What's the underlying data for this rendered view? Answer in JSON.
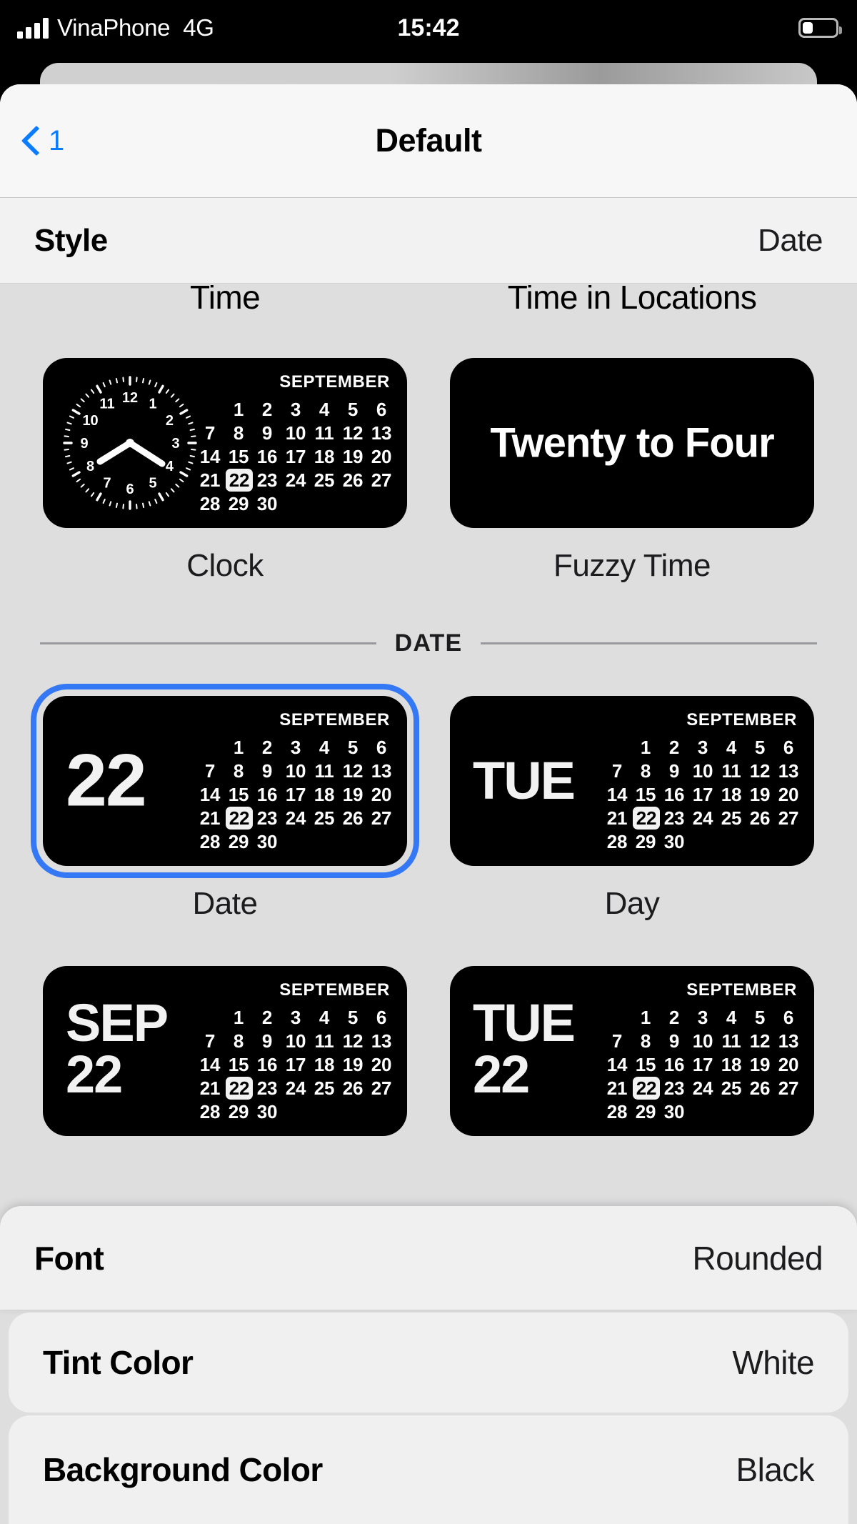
{
  "status_bar": {
    "carrier": "VinaPhone",
    "network": "4G",
    "time": "15:42",
    "battery_level_percent": 32
  },
  "nav": {
    "back_label": "1",
    "title": "Default"
  },
  "style_row": {
    "label": "Style",
    "value": "Date"
  },
  "calendar": {
    "month_label": "SEPTEMBER",
    "today": 22,
    "leading_blanks": 1,
    "days_in_month": 30,
    "weeks": [
      [
        "",
        "1",
        "2",
        "3",
        "4",
        "5",
        "6"
      ],
      [
        "7",
        "8",
        "9",
        "10",
        "11",
        "12",
        "13"
      ],
      [
        "14",
        "15",
        "16",
        "17",
        "18",
        "19",
        "20"
      ],
      [
        "21",
        "22",
        "23",
        "24",
        "25",
        "26",
        "27"
      ],
      [
        "28",
        "29",
        "30",
        "",
        "",
        "",
        ""
      ]
    ]
  },
  "time_section": {
    "cut_labels": [
      "Time",
      "Time in Locations"
    ],
    "items": [
      {
        "label": "Clock",
        "kind": "analog-clock",
        "glyph": "",
        "selected": false
      },
      {
        "label": "Fuzzy Time",
        "kind": "fuzzy",
        "glyph": "Twenty to Four",
        "selected": false
      }
    ]
  },
  "date_section": {
    "header": "DATE",
    "items": [
      {
        "label": "Date",
        "kind": "glyph",
        "glyph": "22",
        "selected": true
      },
      {
        "label": "Day",
        "kind": "glyph",
        "glyph": "TUE",
        "selected": false
      },
      {
        "label": "",
        "kind": "glyph-two-line",
        "glyph_line1": "SEP",
        "glyph_line2": "22",
        "selected": false
      },
      {
        "label": "",
        "kind": "glyph-two-line",
        "glyph_line1": "TUE",
        "glyph_line2": "22",
        "selected": false
      }
    ]
  },
  "clock_widget": {
    "hour_numbers": [
      "12",
      "1",
      "2",
      "3",
      "4",
      "5",
      "6",
      "7",
      "8",
      "9",
      "10",
      "11"
    ],
    "hand_time": "3:42"
  },
  "bottom_options": [
    {
      "label": "Font",
      "value": "Rounded"
    },
    {
      "label": "Tint Color",
      "value": "White"
    },
    {
      "label": "Background Color",
      "value": "Black"
    }
  ],
  "colors": {
    "accent_blue": "#3478f6",
    "nav_tint": "#0a7cff",
    "widget_background": "#000000",
    "scroll_background": "#dededf",
    "sheet_background": "#f5f5f6"
  }
}
